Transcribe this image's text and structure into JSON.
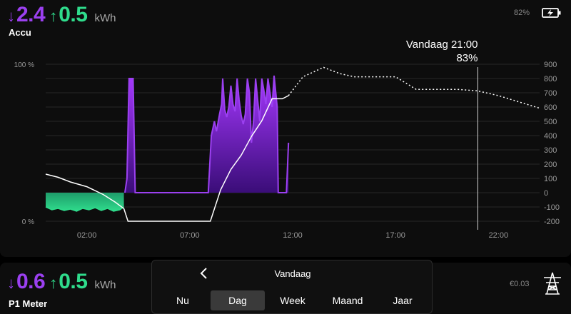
{
  "accu": {
    "title": "Accu",
    "import_value": "2.4",
    "export_value": "0.5",
    "unit": "kWh",
    "battery_percent": "82%",
    "icon": "battery-charging-icon"
  },
  "p1": {
    "title": "P1 Meter",
    "import_value": "0.6",
    "export_value": "0.5",
    "unit": "kWh",
    "cost": "€0.03",
    "icon": "power-pylon-icon"
  },
  "chart_data": {
    "type": "line",
    "left_axis_ticks": [
      "100 %",
      "0 %"
    ],
    "right_axis_ticks": [
      "900",
      "800",
      "700",
      "600",
      "500",
      "400",
      "300",
      "200",
      "100",
      "0",
      "-100",
      "-200"
    ],
    "x_ticks": [
      "02:00",
      "07:00",
      "12:00",
      "17:00",
      "22:00"
    ],
    "x_range_hours": [
      0,
      24
    ],
    "right_ylim": [
      -200,
      900
    ],
    "grid": true,
    "tooltip_time": "Vandaag 21:00",
    "tooltip_value": "83%",
    "tooltip_hour": 21,
    "colors": {
      "discharge": "#9b40f0",
      "charge": "#2fdc8c",
      "soc_line": "#ffffff"
    },
    "series": [
      {
        "kind": "battery_power_w",
        "points": [
          [
            0.0,
            -100
          ],
          [
            0.3,
            -120
          ],
          [
            0.6,
            -110
          ],
          [
            0.9,
            -125
          ],
          [
            1.2,
            -115
          ],
          [
            1.5,
            -130
          ],
          [
            1.8,
            -110
          ],
          [
            2.1,
            -120
          ],
          [
            2.4,
            -105
          ],
          [
            2.7,
            -125
          ],
          [
            3.0,
            -110
          ],
          [
            3.3,
            -130
          ],
          [
            3.6,
            -120
          ],
          [
            3.8,
            -100
          ],
          [
            3.85,
            0
          ],
          [
            3.95,
            100
          ],
          [
            4.05,
            800
          ],
          [
            4.25,
            800
          ],
          [
            4.35,
            0
          ],
          [
            7.9,
            0
          ],
          [
            8.05,
            400
          ],
          [
            8.2,
            500
          ],
          [
            8.3,
            430
          ],
          [
            8.45,
            550
          ],
          [
            8.55,
            620
          ],
          [
            8.6,
            800
          ],
          [
            8.7,
            580
          ],
          [
            8.8,
            530
          ],
          [
            8.9,
            600
          ],
          [
            9.0,
            750
          ],
          [
            9.1,
            620
          ],
          [
            9.2,
            570
          ],
          [
            9.3,
            800
          ],
          [
            9.4,
            650
          ],
          [
            9.5,
            540
          ],
          [
            9.6,
            480
          ],
          [
            9.7,
            550
          ],
          [
            9.8,
            800
          ],
          [
            9.9,
            700
          ],
          [
            10.0,
            350
          ],
          [
            10.1,
            500
          ],
          [
            10.2,
            800
          ],
          [
            10.3,
            650
          ],
          [
            10.4,
            500
          ],
          [
            10.5,
            800
          ],
          [
            10.6,
            720
          ],
          [
            10.7,
            620
          ],
          [
            10.8,
            800
          ],
          [
            10.9,
            700
          ],
          [
            11.0,
            600
          ],
          [
            11.1,
            820
          ],
          [
            11.25,
            600
          ],
          [
            11.3,
            0
          ],
          [
            11.7,
            0
          ],
          [
            11.8,
            350
          ]
        ]
      },
      {
        "kind": "soc_percent_measured",
        "points": [
          [
            0.0,
            30
          ],
          [
            0.6,
            28
          ],
          [
            1.2,
            25
          ],
          [
            2.0,
            22
          ],
          [
            2.8,
            17
          ],
          [
            3.4,
            12
          ],
          [
            3.8,
            8
          ],
          [
            4.0,
            0
          ],
          [
            8.0,
            0
          ],
          [
            8.5,
            20
          ],
          [
            9.0,
            33
          ],
          [
            9.5,
            42
          ],
          [
            10.0,
            54
          ],
          [
            10.5,
            64
          ],
          [
            11.0,
            78
          ],
          [
            11.5,
            78
          ],
          [
            11.8,
            80
          ]
        ]
      },
      {
        "kind": "soc_percent_forecast",
        "points": [
          [
            11.8,
            80
          ],
          [
            12.5,
            92
          ],
          [
            13.5,
            98
          ],
          [
            14.3,
            94
          ],
          [
            15.0,
            92
          ],
          [
            16.0,
            92
          ],
          [
            17.0,
            92
          ],
          [
            18.0,
            84
          ],
          [
            19.0,
            84
          ],
          [
            20.0,
            84
          ],
          [
            21.0,
            83
          ],
          [
            22.0,
            80
          ],
          [
            23.0,
            76
          ],
          [
            24.0,
            72
          ]
        ]
      }
    ]
  },
  "period": {
    "label": "Vandaag",
    "prev_icon": "chevron-left-icon",
    "tabs": [
      "Nu",
      "Dag",
      "Week",
      "Maand",
      "Jaar"
    ],
    "active": "Dag"
  }
}
